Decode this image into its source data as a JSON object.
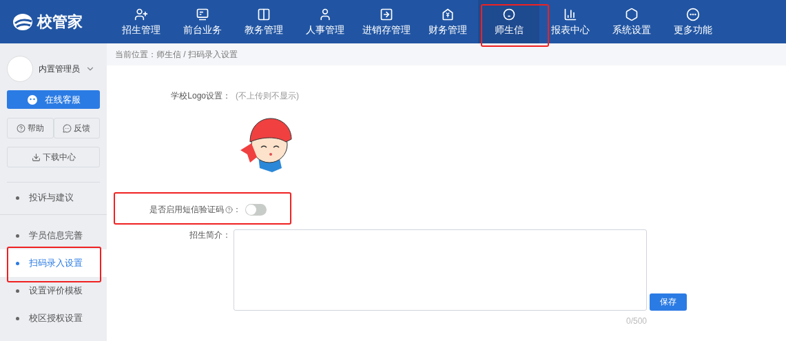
{
  "logo": {
    "text": "校管家"
  },
  "nav": [
    {
      "label": "招生管理",
      "selected": false,
      "highlighted": false
    },
    {
      "label": "前台业务",
      "selected": false,
      "highlighted": false
    },
    {
      "label": "教务管理",
      "selected": false,
      "highlighted": false
    },
    {
      "label": "人事管理",
      "selected": false,
      "highlighted": false
    },
    {
      "label": "进销存管理",
      "selected": false,
      "highlighted": false
    },
    {
      "label": "财务管理",
      "selected": false,
      "highlighted": false
    },
    {
      "label": "师生信",
      "selected": true,
      "highlighted": true
    },
    {
      "label": "报表中心",
      "selected": false,
      "highlighted": false
    },
    {
      "label": "系统设置",
      "selected": false,
      "highlighted": false
    },
    {
      "label": "更多功能",
      "selected": false,
      "highlighted": false
    }
  ],
  "sidebar": {
    "user": "内置管理员",
    "service_button": "在线客服",
    "help_button": "帮助",
    "feedback_button": "反馈",
    "download_button": "下载中心",
    "groups": [
      [
        {
          "label": "投诉与建议",
          "selected": false,
          "highlighted": false
        }
      ],
      [
        {
          "label": "学员信息完善",
          "selected": false,
          "highlighted": false
        },
        {
          "label": "扫码录入设置",
          "selected": true,
          "highlighted": true
        },
        {
          "label": "设置评价模板",
          "selected": false,
          "highlighted": false
        },
        {
          "label": "校区授权设置",
          "selected": false,
          "highlighted": false
        }
      ]
    ]
  },
  "breadcrumb": "当前位置：师生信 / 扫码录入设置",
  "form": {
    "logo_label": "学校Logo设置：",
    "logo_hint": "(不上传则不显示)",
    "sms_label": "是否启用短信验证码",
    "sms_colon": "：",
    "sms_on": false,
    "sms_highlighted": true,
    "intro_label": "招生简介：",
    "intro_counter": "0/500",
    "save_button": "保存"
  }
}
